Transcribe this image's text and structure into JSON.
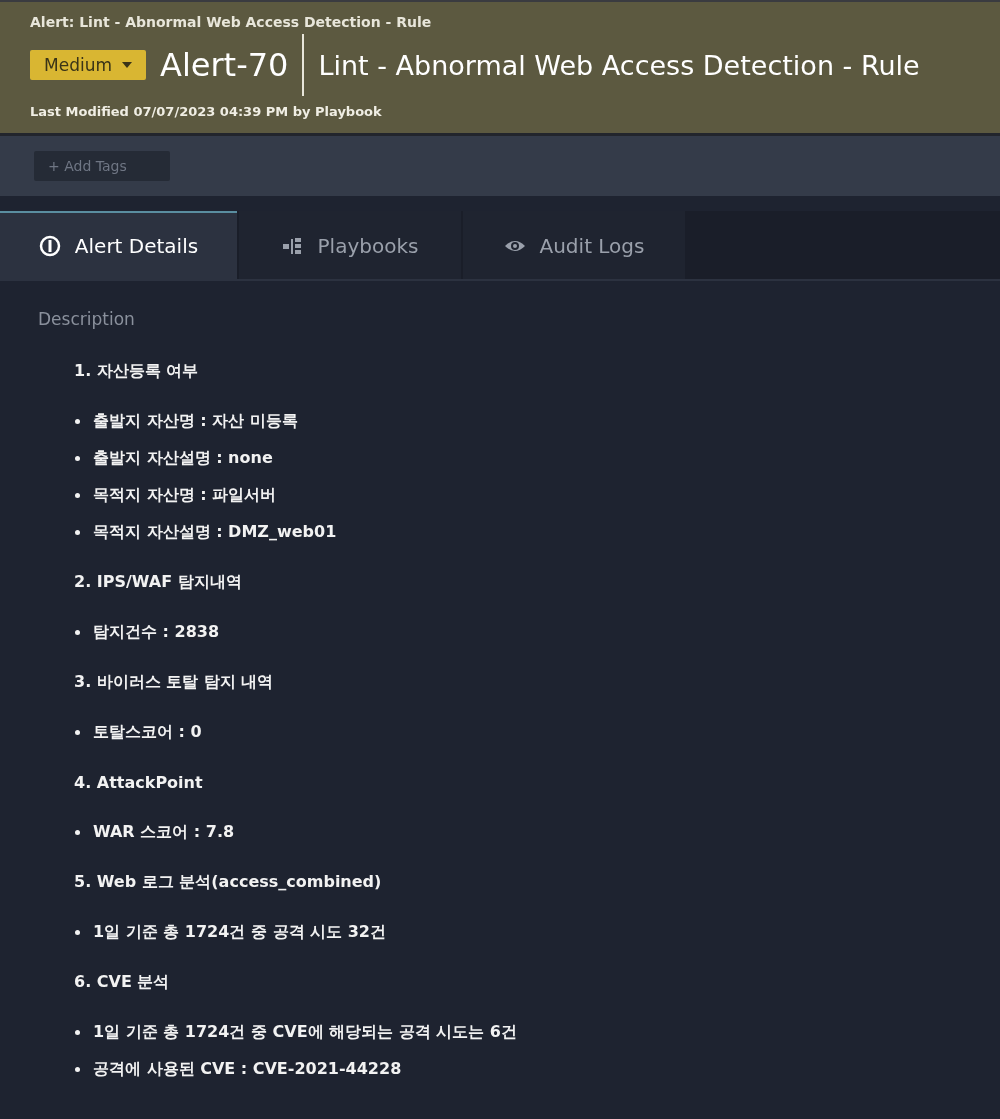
{
  "header": {
    "breadcrumb": "Alert: Lint - Abnormal Web Access Detection - Rule",
    "severity": "Medium",
    "alert_id": "Alert-70",
    "title": "Lint - Abnormal Web Access Detection - Rule",
    "last_modified": "Last Modified 07/07/2023 04:39 PM by Playbook"
  },
  "tags": {
    "add_label": "+ Add Tags"
  },
  "tabs": [
    {
      "label": "Alert Details",
      "kind": "alert",
      "selected": true
    },
    {
      "label": "Playbooks",
      "kind": "playbook",
      "selected": false
    },
    {
      "label": "Audit Logs",
      "kind": "eye",
      "selected": false
    }
  ],
  "description": {
    "label": "Description",
    "items": [
      {
        "kind": "heading",
        "text": "1. 자산등록 여부"
      },
      {
        "kind": "bullet",
        "text": "출발지 자산명 : 자산 미등록"
      },
      {
        "kind": "bullet",
        "text": "출발지 자산설명 : none"
      },
      {
        "kind": "bullet",
        "text": "목적지 자산명 : 파일서버"
      },
      {
        "kind": "bullet",
        "text": "목적지 자산설명 : DMZ_web01"
      },
      {
        "kind": "heading",
        "text": "2. IPS/WAF 탐지내역"
      },
      {
        "kind": "bullet",
        "text": "탐지건수 : 2838"
      },
      {
        "kind": "heading",
        "text": "3. 바이러스 토탈 탐지 내역"
      },
      {
        "kind": "bullet",
        "text": "토탈스코어 : 0"
      },
      {
        "kind": "heading",
        "text": "4. AttackPoint"
      },
      {
        "kind": "bullet",
        "text": "WAR 스코어 : 7.8"
      },
      {
        "kind": "heading",
        "text": "5. Web 로그 분석(access_combined)"
      },
      {
        "kind": "bullet",
        "text": "1일 기준 총 1724건 중 공격 시도 32건"
      },
      {
        "kind": "heading",
        "text": "6. CVE 분석"
      },
      {
        "kind": "bullet",
        "text": "1일 기준 총 1724건 중 CVE에 해당되는 공격 시도는 6건"
      },
      {
        "kind": "bullet",
        "text": "공격에 사용된 CVE : CVE-2021-44228"
      }
    ]
  }
}
